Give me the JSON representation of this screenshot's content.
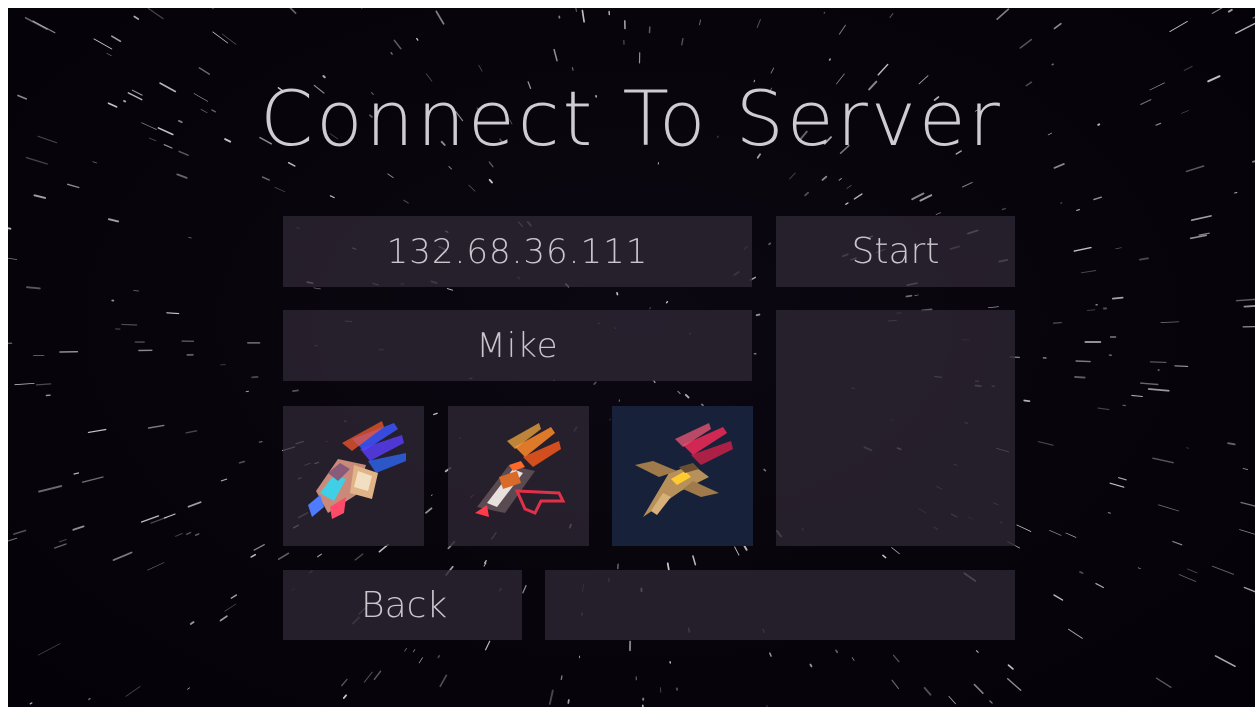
{
  "screen": {
    "title": "Connect To Server"
  },
  "form": {
    "server_address": "132.68.36.111",
    "player_name": "Mike",
    "start_label": "Start",
    "back_label": "Back",
    "status_message": ""
  },
  "ships": [
    {
      "icon": "blue-flame-ship-icon",
      "selected": false
    },
    {
      "icon": "orange-flame-ship-icon",
      "selected": false
    },
    {
      "icon": "red-flame-jet-ship-icon",
      "selected": true
    }
  ],
  "colors": {
    "background": "#07040b",
    "panel": "#2e2634",
    "selected_slot": "#17223a",
    "text": "#cfcbd3"
  }
}
